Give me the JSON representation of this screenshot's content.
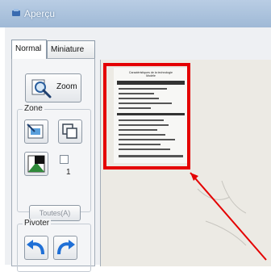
{
  "window": {
    "title": "Aperçu"
  },
  "tabs": [
    {
      "label": "Normal"
    },
    {
      "label": "Miniature"
    }
  ],
  "toolbar": {
    "zoom_label": "Zoom",
    "zone_label": "Zone",
    "count": "1",
    "all_label": "Toutes(A)",
    "rotate_label": "Pivoter"
  },
  "document": {
    "heading": "Caractéristiques de la technologie",
    "heading_sub": "Modèle"
  },
  "colors": {
    "highlight": "#e40000",
    "arrow": "#e40000",
    "titlebar": "#a9c2dd"
  }
}
